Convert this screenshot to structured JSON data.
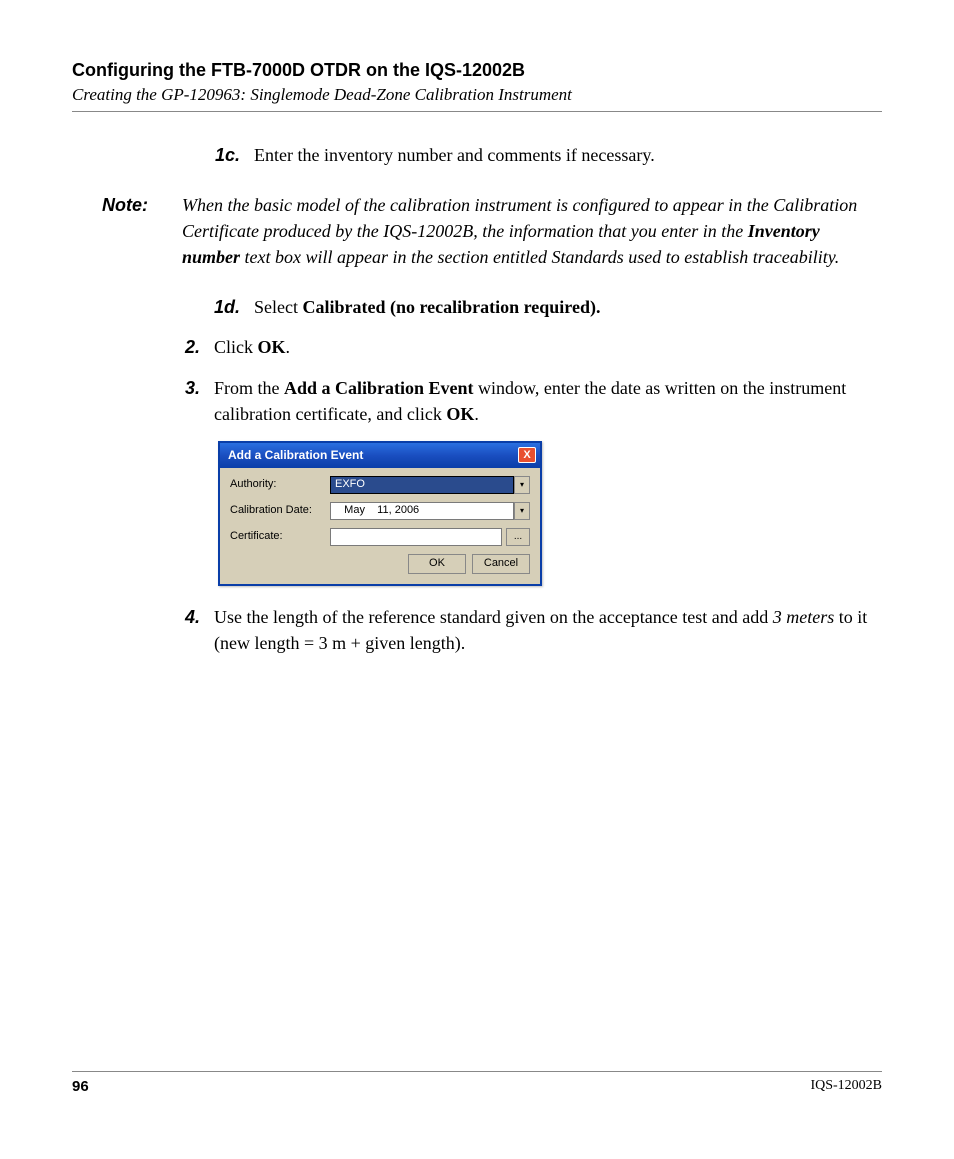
{
  "header": {
    "title": "Configuring the FTB-7000D OTDR on the IQS-12002B",
    "subtitle": "Creating the GP-120963: Singlemode Dead-Zone Calibration Instrument"
  },
  "steps": {
    "s1c": {
      "num": "1c.",
      "text": "Enter the inventory number and comments if necessary."
    },
    "note": {
      "label": "Note:",
      "pre": "When the basic model of the calibration instrument is configured to appear in the Calibration Certificate produced by the IQS-12002B, the information that you enter in the ",
      "bold": "Inventory number",
      "post": " text box will appear in the section entitled Standards used to establish traceability."
    },
    "s1d": {
      "num": "1d.",
      "pre": "Select ",
      "bold": "Calibrated (no recalibration required)."
    },
    "s2": {
      "num": "2.",
      "pre": "Click ",
      "bold": "OK",
      "post": "."
    },
    "s3": {
      "num": "3.",
      "pre": "From the ",
      "bold1": "Add a Calibration Event",
      "mid": " window, enter the date as written on the instrument calibration certificate, and click ",
      "bold2": "OK",
      "post": "."
    },
    "s4": {
      "num": "4.",
      "pre": "Use the length of the reference standard given on the acceptance test and add ",
      "it": "3 meters",
      "post": " to it (new length = 3 m + given length)."
    }
  },
  "dialog": {
    "title": "Add a Calibration Event",
    "close": "X",
    "rows": {
      "authority": {
        "label": "Authority:",
        "value": "EXFO"
      },
      "caldate": {
        "label": "Calibration Date:",
        "value": "   May    11, 2006"
      },
      "certificate": {
        "label": "Certificate:",
        "value": ""
      }
    },
    "dropdown_glyph": "▾",
    "browse": "...",
    "ok": "OK",
    "cancel": "Cancel"
  },
  "footer": {
    "page": "96",
    "model": "IQS-12002B"
  }
}
